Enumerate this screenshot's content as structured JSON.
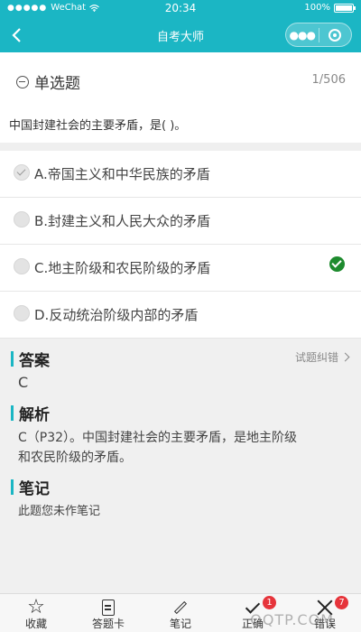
{
  "status_bar": {
    "signal_dots": "●●●●●",
    "carrier": "WeChat",
    "time": "20:34",
    "battery_pct": "100%"
  },
  "nav": {
    "title": "自考大师",
    "back_icon": "back-chevron-icon",
    "more_dots": "●●●",
    "close_icon": "target-icon"
  },
  "question": {
    "type_label": "单选题",
    "progress": "1/506",
    "text": "中国封建社会的主要矛盾，是( )。"
  },
  "options": [
    {
      "label": "A.帝国主义和中华民族的矛盾",
      "checked": true,
      "correct": false
    },
    {
      "label": "B.封建主义和人民大众的矛盾",
      "checked": false,
      "correct": false
    },
    {
      "label": "C.地主阶级和农民阶级的矛盾",
      "checked": false,
      "correct": true
    },
    {
      "label": "D.反动统治阶级内部的矛盾",
      "checked": false,
      "correct": false
    }
  ],
  "answer": {
    "title": "答案",
    "value": "C",
    "report_link": "试题纠错"
  },
  "analysis": {
    "title": "解析",
    "line1": "C（P32）。中国封建社会的主要矛盾，是地主阶级",
    "line2": "和农民阶级的矛盾。"
  },
  "notes": {
    "title": "笔记",
    "body": "此题您未作笔记"
  },
  "toolbar": {
    "favorite_label": "收藏",
    "answer_card_label": "答题卡",
    "note_label": "笔记",
    "correct_label": "正确",
    "correct_count": "1",
    "wrong_label": "错误",
    "wrong_count": "7"
  },
  "watermark": "QQTP.COM",
  "colors": {
    "accent": "#1bb6c4",
    "correct": "#1e8b2e",
    "badge": "#e6343b"
  }
}
